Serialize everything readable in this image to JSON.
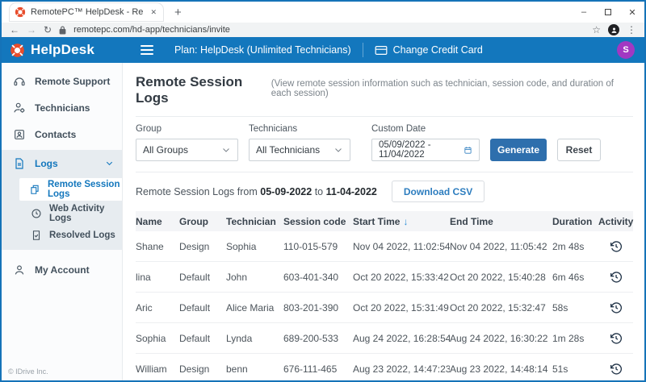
{
  "colors": {
    "header_blue": "#1377bd",
    "button_blue": "#2e6fad",
    "link_blue": "#2d7dbf",
    "logo_red": "#e84c2b",
    "avatar_purple": "#a238c2",
    "window_border": "#1573b8"
  },
  "chrome": {
    "tab_title": "RemotePC™ HelpDesk - Remote",
    "tab_close": "✕",
    "new_tab": "+",
    "minimize": "–",
    "close": "✕",
    "back": "←",
    "forward": "→",
    "reload": "↻",
    "url": "remotepc.com/hd-app/technicians/invite",
    "star": "☆",
    "menu_dots": "⋮"
  },
  "header": {
    "brand": "HelpDesk",
    "plan": "Plan: HelpDesk (Unlimited Technicians)",
    "change_card": "Change Credit Card",
    "avatar_initial": "S"
  },
  "sidebar": {
    "remote_support": "Remote Support",
    "technicians": "Technicians",
    "contacts": "Contacts",
    "logs": "Logs",
    "remote_session_logs": "Remote Session Logs",
    "web_activity_logs": "Web Activity Logs",
    "resolved_logs": "Resolved Logs",
    "my_account": "My Account",
    "footer": "© IDrive Inc."
  },
  "main": {
    "title": "Remote Session Logs",
    "subtitle": "(View remote session information such as technician, session code, and duration of each session)",
    "filters": {
      "group_label": "Group",
      "group_value": "All Groups",
      "technicians_label": "Technicians",
      "technicians_value": "All Technicians",
      "date_label": "Custom Date",
      "date_value": "05/09/2022 - 11/04/2022",
      "generate": "Generate",
      "reset": "Reset"
    },
    "summary": {
      "prefix": "Remote Session Logs from",
      "from_date": "05-09-2022",
      "mid": "to",
      "to_date": "11-04-2022",
      "download": "Download CSV"
    },
    "table": {
      "columns": [
        "Name",
        "Group",
        "Technician",
        "Session code",
        "Start Time",
        "End Time",
        "Duration",
        "Activity"
      ],
      "sort_arrow": "↓",
      "rows": [
        {
          "name": "Shane",
          "group": "Design",
          "technician": "Sophia",
          "code": "110-015-579",
          "start": "Nov 04 2022, 11:02:54",
          "end": "Nov 04 2022, 11:05:42",
          "duration": "2m 48s"
        },
        {
          "name": "lina",
          "group": "Default",
          "technician": "John",
          "code": "603-401-340",
          "start": "Oct 20 2022, 15:33:42",
          "end": "Oct 20 2022, 15:40:28",
          "duration": "6m 46s"
        },
        {
          "name": "Aric",
          "group": "Default",
          "technician": "Alice Maria",
          "code": "803-201-390",
          "start": "Oct 20 2022, 15:31:49",
          "end": "Oct 20 2022, 15:32:47",
          "duration": "58s"
        },
        {
          "name": "Sophia",
          "group": "Default",
          "technician": "Lynda",
          "code": "689-200-533",
          "start": "Aug 24 2022, 16:28:54",
          "end": "Aug 24 2022, 16:30:22",
          "duration": "1m 28s"
        },
        {
          "name": "William",
          "group": "Design",
          "technician": "benn",
          "code": "676-111-465",
          "start": "Aug 23 2022, 14:47:23",
          "end": "Aug 23 2022, 14:48:14",
          "duration": "51s"
        }
      ]
    }
  }
}
